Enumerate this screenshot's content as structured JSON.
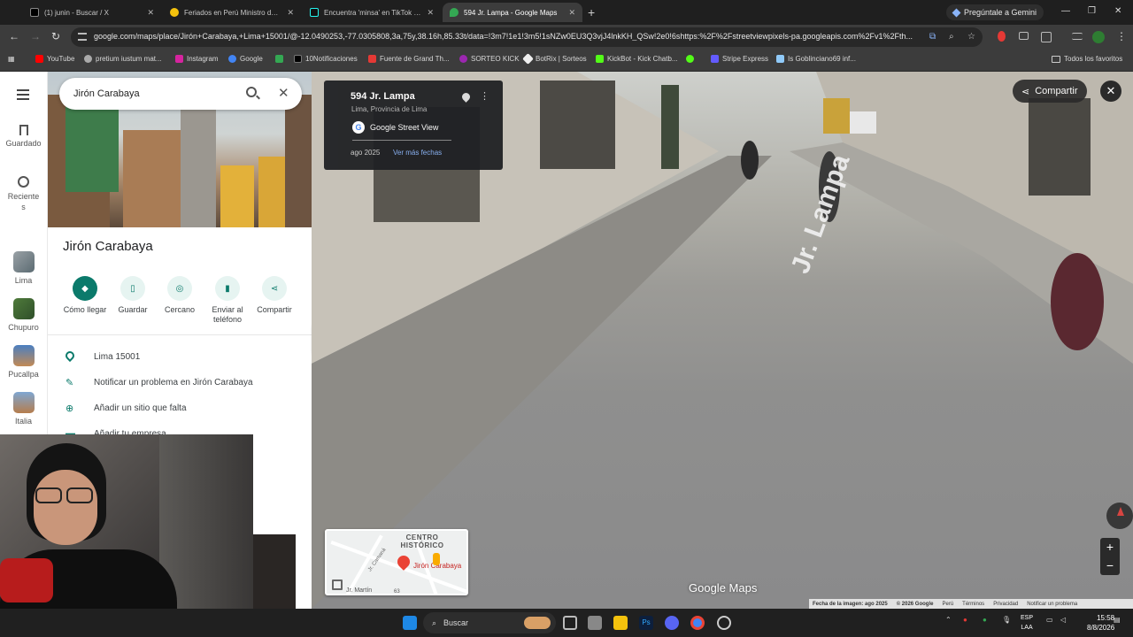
{
  "browser": {
    "tabs": [
      {
        "label": "(1) junin - Buscar / X",
        "active": false
      },
      {
        "label": "Feriados en Perú Ministro de Ec",
        "active": false
      },
      {
        "label": "Encuentra 'minsa' en TikTok | B",
        "active": false
      },
      {
        "label": "594 Jr. Lampa - Google Maps",
        "active": true
      }
    ],
    "gemini_label": "Pregúntale a Gemini",
    "url": "google.com/maps/place/Jirón+Carabaya,+Lima+15001/@-12.0490253,-77.0305808,3a,75y,38.16h,85.33t/data=!3m7!1e1!3m5!1sNZw0EU3Q3vjJ4lnkKH_QSw!2e0!6shttps:%2F%2Fstreetviewpixels-pa.googleapis.com%2Fv1%2Fth...",
    "bookmarks": [
      {
        "label": "YouTube",
        "color": "#ff0000"
      },
      {
        "label": "pretium iustum mat...",
        "color": "#aaaaaa"
      },
      {
        "label": "Instagram",
        "color": "#d6249f"
      },
      {
        "label": "Google",
        "color": "#4285f4"
      },
      {
        "label": "",
        "color": "#34a853"
      },
      {
        "label": "10Notificaciones",
        "color": "#000000"
      },
      {
        "label": "Fuente de Grand Th...",
        "color": "#e53935"
      },
      {
        "label": "SORTEO KICK",
        "color": "#9c27b0"
      },
      {
        "label": "BotRix | Sorteos",
        "color": "#eeeeee"
      },
      {
        "label": "KickBot - Kick Chatb...",
        "color": "#53fc18"
      },
      {
        "label": "",
        "color": "#53fc18"
      },
      {
        "label": "Stripe Express",
        "color": "#635bff"
      },
      {
        "label": "Is Goblinciano69 inf...",
        "color": "#90caf9"
      }
    ],
    "all_bookmarks_label": "Todos los favoritos"
  },
  "sidebar": {
    "items": [
      {
        "label": "Guardado"
      },
      {
        "label": "Recientes"
      },
      {
        "label": "Lima"
      },
      {
        "label": "Chupuro"
      },
      {
        "label": "Pucallpa"
      },
      {
        "label": "Italia"
      }
    ]
  },
  "search": {
    "value": "Jirón Carabaya"
  },
  "place": {
    "name": "Jirón Carabaya",
    "actions": [
      {
        "label": "Cómo llegar"
      },
      {
        "label": "Guardar"
      },
      {
        "label": "Cercano"
      },
      {
        "label": "Enviar al teléfono"
      },
      {
        "label": "Compartir"
      }
    ],
    "rows": [
      {
        "text": "Lima 15001"
      },
      {
        "text": "Notificar un problema en Jirón Carabaya"
      },
      {
        "text": "Añadir un sitio que falta"
      },
      {
        "text": "Añadir tu empresa"
      }
    ]
  },
  "streetview": {
    "title": "594 Jr. Lampa",
    "subtitle": "Lima, Provincia de Lima",
    "brand": "Google Street View",
    "date": "ago 2025",
    "more_dates": "Ver más fechas",
    "share_label": "Compartir",
    "street_label": "Jr. Lampa",
    "logo": "Google Maps",
    "footer": [
      "Fecha de la imagen: ago 2025",
      "© 2026 Google",
      "Perú",
      "Términos",
      "Privacidad",
      "Notificar un problema"
    ]
  },
  "minimap": {
    "area_label": "CENTRO HISTÓRICO",
    "street_a": "Jr. Camaná",
    "pin_label": "Jirón Carabaya",
    "bottom_label": "Jr. Martín",
    "badge": "63"
  },
  "taskbar": {
    "search_label": "Buscar",
    "lang": "ESP",
    "lang_sub": "LAA",
    "time": "15:58",
    "date": "8/8/2026"
  }
}
